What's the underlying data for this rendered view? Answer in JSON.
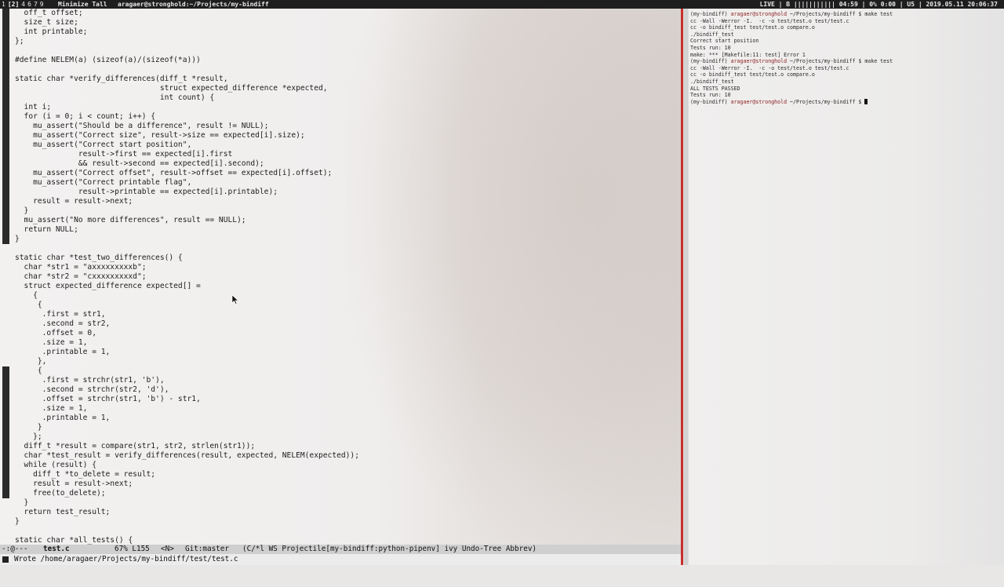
{
  "topbar": {
    "workspaces": [
      "1",
      "[2]",
      "4",
      "6",
      "7",
      "9"
    ],
    "current_workspace": "[2]",
    "layout": "Minimize Tall",
    "window_title": "aragaer@stronghold:~/Projects/my-bindiff",
    "status": "LIVE | B ||||||||||| 04:59 | 0% 0:00 | U5 | 2019.05.11 20:06:37"
  },
  "editor": {
    "lines": [
      "  off_t offset;",
      "  size_t size;",
      "  int printable;",
      "};",
      "",
      "#define NELEM(a) (sizeof(a)/(sizeof(*a)))",
      "",
      "static char *verify_differences(diff_t *result,",
      "                                struct expected_difference *expected,",
      "                                int count) {",
      "  int i;",
      "  for (i = 0; i < count; i++) {",
      "    mu_assert(\"Should be a difference\", result != NULL);",
      "    mu_assert(\"Correct size\", result->size == expected[i].size);",
      "    mu_assert(\"Correct start position\",",
      "              result->first == expected[i].first",
      "              && result->second == expected[i].second);",
      "    mu_assert(\"Correct offset\", result->offset == expected[i].offset);",
      "    mu_assert(\"Correct printable flag\",",
      "              result->printable == expected[i].printable);",
      "    result = result->next;",
      "  }",
      "  mu_assert(\"No more differences\", result == NULL);",
      "  return NULL;",
      "}",
      "",
      "static char *test_two_differences() {",
      "  char *str1 = \"axxxxxxxxxb\";",
      "  char *str2 = \"cxxxxxxxxxd\";",
      "  struct expected_difference expected[] =",
      "    {",
      "     {",
      "      .first = str1,",
      "      .second = str2,",
      "      .offset = 0,",
      "      .size = 1,",
      "      .printable = 1,",
      "     },",
      "     {",
      "      .first = strchr(str1, 'b'),",
      "      .second = strchr(str2, 'd'),",
      "      .offset = strchr(str1, 'b') - str1,",
      "      .size = 1,",
      "      .printable = 1,",
      "     }",
      "    };",
      "  diff_t *result = compare(str1, str2, strlen(str1));",
      "  char *test_result = verify_differences(result, expected, NELEM(expected));",
      "  while (result) {",
      "    diff_t *to_delete = result;",
      "    result = result->next;",
      "    free(to_delete);",
      "  }",
      "  return test_result;",
      "}",
      "",
      "static char *all_tests() {"
    ]
  },
  "modeline": {
    "state": "-:@---",
    "buffer": "test.c",
    "position": "67% L155",
    "evil_state": "<N>",
    "vc": "Git:master",
    "modes": "(C/*l WS Projectile[my-bindiff:python-pipenv] ivy Undo-Tree Abbrev)"
  },
  "echo_area": {
    "message": "Wrote /home/aragaer/Projects/my-bindiff/test/test.c"
  },
  "terminal": {
    "lines": [
      {
        "prompt": "(my-bindiff) ",
        "user": "aragaer@stronghold",
        "rest": " ~/Projects/my-bindiff $ make test"
      },
      {
        "text": "cc -Wall -Werror -I.  -c -o test/test.o test/test.c"
      },
      {
        "text": "cc -o bindiff_test test/test.o compare.o"
      },
      {
        "text": "./bindiff_test"
      },
      {
        "text": "Correct start position"
      },
      {
        "text": "Tests run: 10"
      },
      {
        "text": "make: *** [Makefile:11: test] Error 1"
      },
      {
        "prompt": "(my-bindiff) ",
        "user": "aragaer@stronghold",
        "rest": " ~/Projects/my-bindiff $ make test"
      },
      {
        "text": "cc -Wall -Werror -I.  -c -o test/test.o test/test.c"
      },
      {
        "text": "cc -o bindiff_test test/test.o compare.o"
      },
      {
        "text": "./bindiff_test"
      },
      {
        "text": "ALL TESTS PASSED"
      },
      {
        "text": "Tests run: 10"
      },
      {
        "prompt": "(my-bindiff) ",
        "user": "aragaer@stronghold",
        "rest": " ~/Projects/my-bindiff $ ",
        "cursor": true
      }
    ]
  }
}
